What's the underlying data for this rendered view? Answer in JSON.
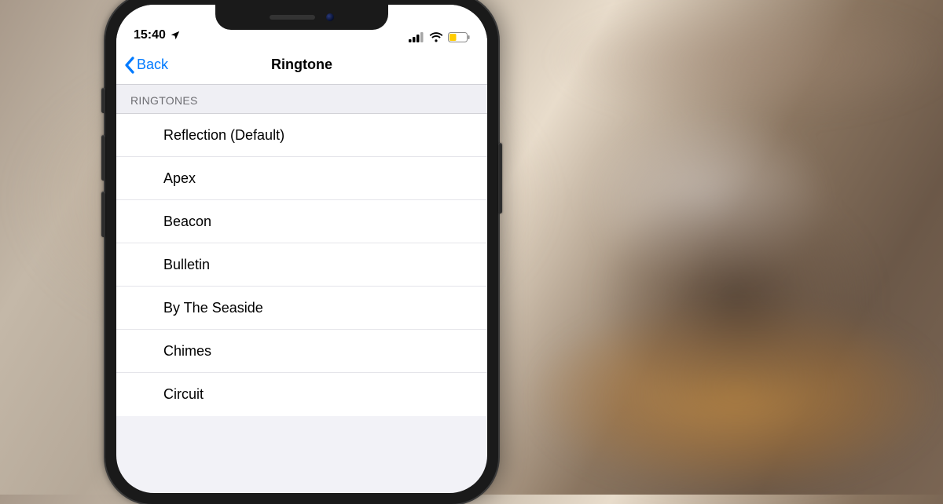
{
  "status_bar": {
    "time": "15:40",
    "location_icon": "location-arrow",
    "signal_bars": 4,
    "wifi": true,
    "battery": {
      "level_percent": 38,
      "low_power_mode": true,
      "color": "#ffcc00"
    }
  },
  "nav": {
    "back_label": "Back",
    "title": "Ringtone"
  },
  "section_header": "RINGTONES",
  "ringtones": [
    "Reflection (Default)",
    "Apex",
    "Beacon",
    "Bulletin",
    "By The Seaside",
    "Chimes",
    "Circuit"
  ],
  "colors": {
    "ios_blue": "#007aff",
    "group_bg": "#efeff4",
    "separator": "#d1d1d6"
  }
}
